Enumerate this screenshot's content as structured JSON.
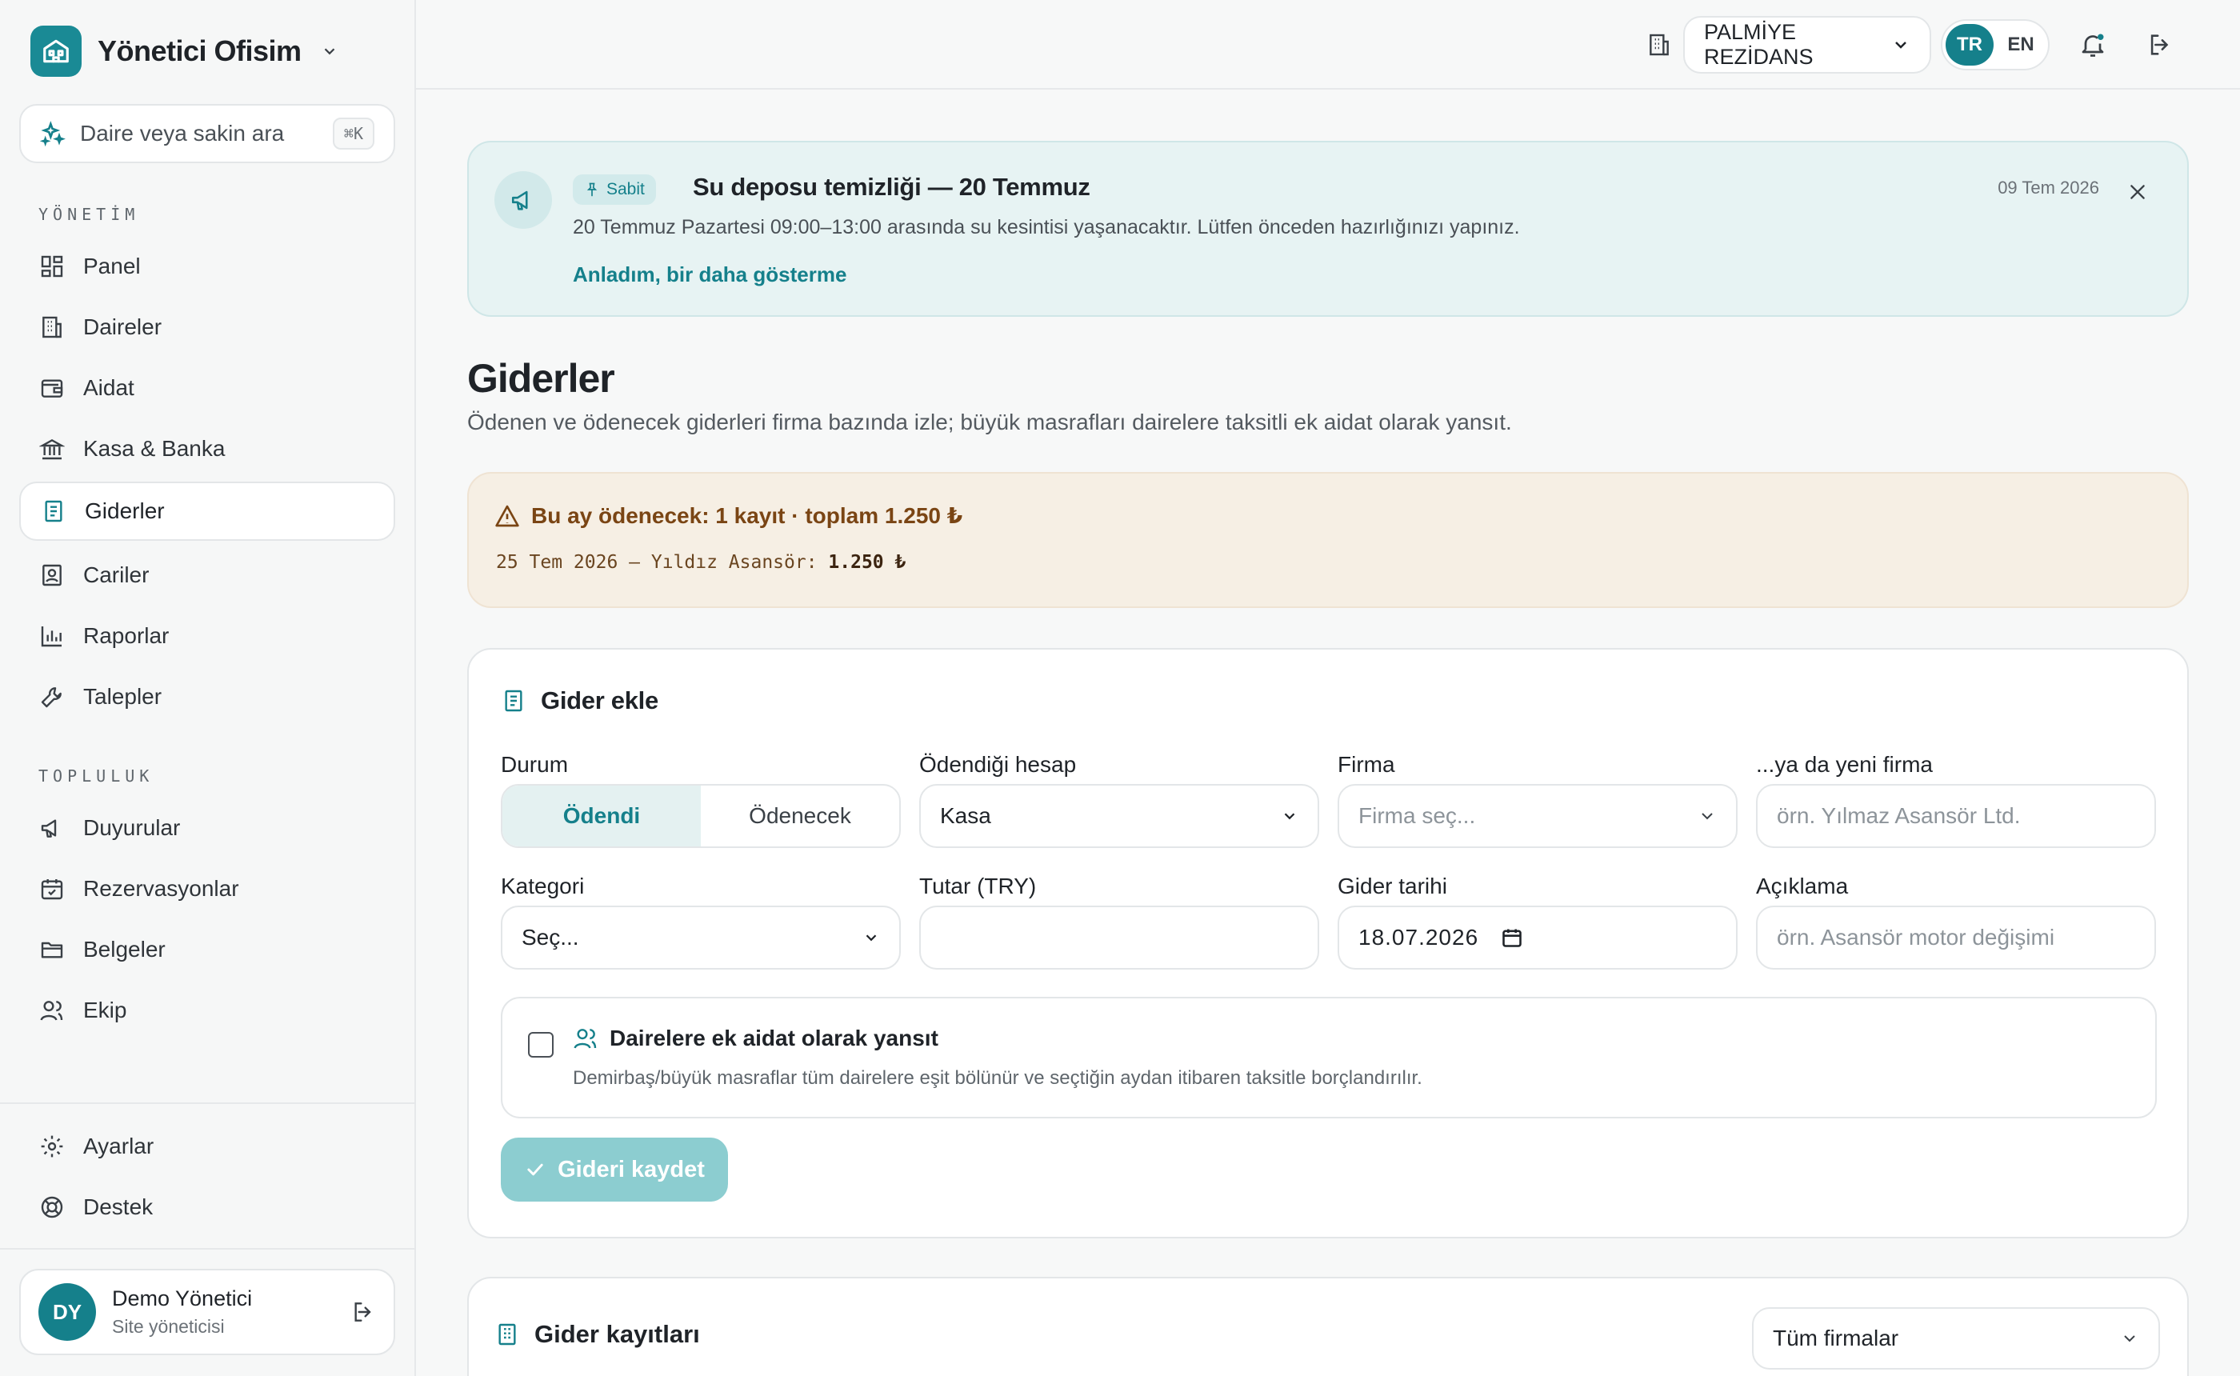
{
  "app": {
    "brand_name": "Yönetici Ofisim",
    "search_placeholder": "Daire veya sakin ara",
    "search_shortcut": "⌘K"
  },
  "sidebar": {
    "sections": [
      {
        "label": "YÖNETİM",
        "items": [
          {
            "label": "Panel",
            "icon": "grid-icon"
          },
          {
            "label": "Daireler",
            "icon": "building-icon"
          },
          {
            "label": "Aidat",
            "icon": "wallet-icon"
          },
          {
            "label": "Kasa & Banka",
            "icon": "bank-icon"
          },
          {
            "label": "Giderler",
            "icon": "receipt-icon",
            "active": true
          },
          {
            "label": "Cariler",
            "icon": "contact-book-icon"
          },
          {
            "label": "Raporlar",
            "icon": "bar-chart-icon"
          },
          {
            "label": "Talepler",
            "icon": "wrench-icon"
          }
        ]
      },
      {
        "label": "TOPLULUK",
        "items": [
          {
            "label": "Duyurular",
            "icon": "megaphone-icon"
          },
          {
            "label": "Rezervasyonlar",
            "icon": "calendar-icon"
          },
          {
            "label": "Belgeler",
            "icon": "folder-icon"
          },
          {
            "label": "Ekip",
            "icon": "users-icon"
          }
        ]
      }
    ],
    "bottom_items": [
      {
        "label": "Ayarlar",
        "icon": "gear-icon"
      },
      {
        "label": "Destek",
        "icon": "lifebuoy-icon"
      }
    ],
    "user": {
      "initials": "DY",
      "name": "Demo Yönetici",
      "role": "Site yöneticisi"
    }
  },
  "topbar": {
    "site_name": "PALMİYE REZİDANS",
    "languages": [
      "TR",
      "EN"
    ],
    "active_language": "TR"
  },
  "announcement": {
    "badge": "Sabit",
    "title": "Su deposu temizliği — 20 Temmuz",
    "date": "09 Tem 2026",
    "body": "20 Temmuz Pazartesi 09:00–13:00 arasında su kesintisi yaşanacaktır. Lütfen önceden hazırlığınızı yapınız.",
    "dismiss_link": "Anladım, bir daha gösterme"
  },
  "page": {
    "title": "Giderler",
    "subtitle": "Ödenen ve ödenecek giderleri firma bazında izle; büyük masrafları dairelere taksitli ek aidat olarak yansıt."
  },
  "warning": {
    "heading": "Bu ay ödenecek: 1 kayıt · toplam 1.250 ₺",
    "line_prefix": "25 Tem 2026 — Yıldız Asansör: ",
    "line_amount": "1.250 ₺"
  },
  "form": {
    "title": "Gider ekle",
    "status_label": "Durum",
    "status_options": [
      "Ödendi",
      "Ödenecek"
    ],
    "status_selected": "Ödendi",
    "account_label": "Ödendiği hesap",
    "account_value": "Kasa",
    "firm_label": "Firma",
    "firm_placeholder": "Firma seç...",
    "new_firm_label": "...ya da yeni firma",
    "new_firm_placeholder": "örn. Yılmaz Asansör Ltd.",
    "category_label": "Kategori",
    "category_placeholder": "Seç...",
    "amount_label": "Tutar (TRY)",
    "amount_value": "",
    "date_label": "Gider tarihi",
    "date_value": "18.07.2026",
    "description_label": "Açıklama",
    "description_placeholder": "örn. Asansör motor değişimi",
    "reflect_title": "Dairelere ek aidat olarak yansıt",
    "reflect_desc": "Demirbaş/büyük masraflar tüm dairelere eşit bölünür ve seçtiğin aydan itibaren taksitle borçlandırılır.",
    "reflect_checked": false,
    "save_label": "Gideri kaydet"
  },
  "records": {
    "title": "Gider kayıtları",
    "filter_value": "Tüm firmalar"
  },
  "colors": {
    "accent": "#15808b",
    "announcement_bg": "#e7f3f3",
    "warning_bg": "#f6efe4",
    "save_disabled": "#8ccdd0"
  }
}
